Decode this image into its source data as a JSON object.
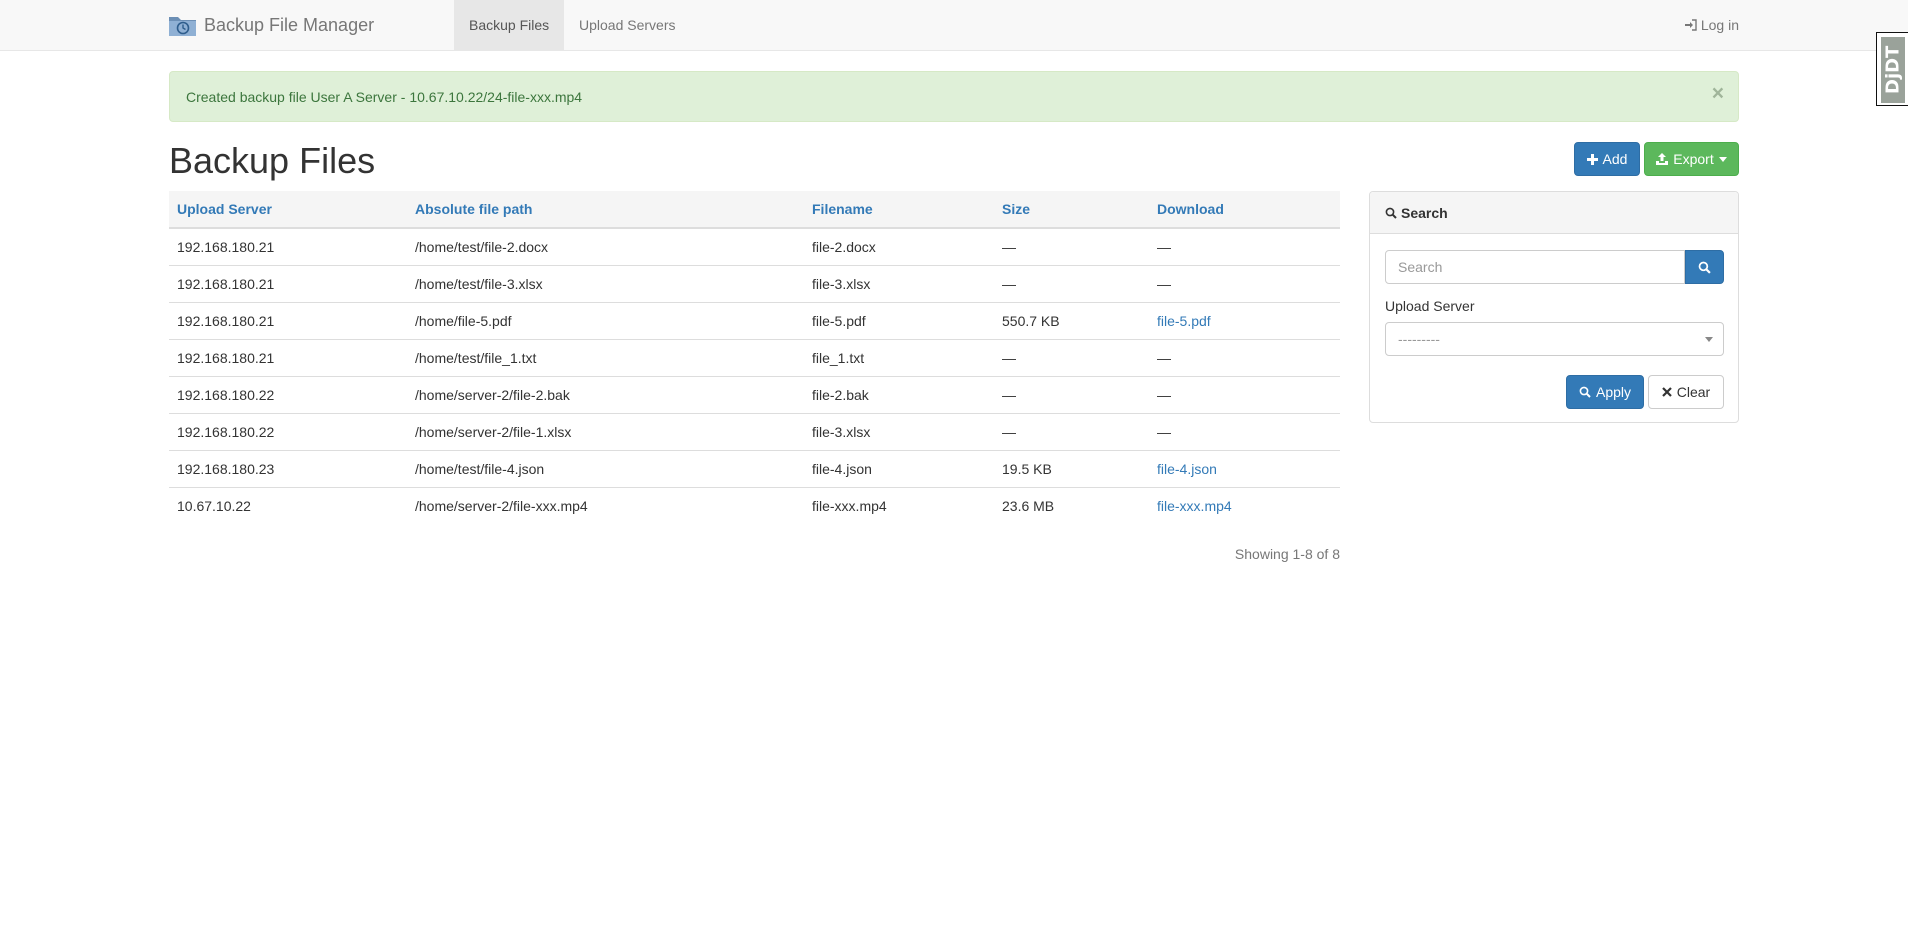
{
  "navbar": {
    "brand": "Backup File Manager",
    "tabs": [
      {
        "label": "Backup Files",
        "active": true
      },
      {
        "label": "Upload Servers",
        "active": false
      }
    ],
    "login": "Log in"
  },
  "debug_toolbar": {
    "label": "DjDT"
  },
  "alert": {
    "message": "Created backup file User A Server - 10.67.10.22/24-file-xxx.mp4",
    "close": "×"
  },
  "page": {
    "title": "Backup Files"
  },
  "actions": {
    "add_label": "Add",
    "export_label": "Export"
  },
  "table": {
    "headers": [
      "Upload Server",
      "Absolute file path",
      "Filename",
      "Size",
      "Download"
    ],
    "rows": [
      {
        "server": "192.168.180.21",
        "path": "/home/test/file-2.docx",
        "filename": "file-2.docx",
        "size": "—",
        "download": "—",
        "download_link": false
      },
      {
        "server": "192.168.180.21",
        "path": "/home/test/file-3.xlsx",
        "filename": "file-3.xlsx",
        "size": "—",
        "download": "—",
        "download_link": false
      },
      {
        "server": "192.168.180.21",
        "path": "/home/file-5.pdf",
        "filename": "file-5.pdf",
        "size": "550.7 KB",
        "download": "file-5.pdf",
        "download_link": true
      },
      {
        "server": "192.168.180.21",
        "path": "/home/test/file_1.txt",
        "filename": "file_1.txt",
        "size": "—",
        "download": "—",
        "download_link": false
      },
      {
        "server": "192.168.180.22",
        "path": "/home/server-2/file-2.bak",
        "filename": "file-2.bak",
        "size": "—",
        "download": "—",
        "download_link": false
      },
      {
        "server": "192.168.180.22",
        "path": "/home/server-2/file-1.xlsx",
        "filename": "file-3.xlsx",
        "size": "—",
        "download": "—",
        "download_link": false
      },
      {
        "server": "192.168.180.23",
        "path": "/home/test/file-4.json",
        "filename": "file-4.json",
        "size": "19.5 KB",
        "download": "file-4.json",
        "download_link": true
      },
      {
        "server": "10.67.10.22",
        "path": "/home/server-2/file-xxx.mp4",
        "filename": "file-xxx.mp4",
        "size": "23.6 MB",
        "download": "file-xxx.mp4",
        "download_link": true
      }
    ],
    "showing": "Showing 1-8 of 8"
  },
  "search_panel": {
    "title": "Search",
    "search_placeholder": "Search",
    "upload_server_label": "Upload Server",
    "upload_server_value": "---------",
    "apply_label": "Apply",
    "clear_label": "Clear"
  },
  "colors": {
    "primary": "#337ab7",
    "success": "#5cb85c",
    "alert_bg": "#dff0d8",
    "alert_text": "#3c763d",
    "navbar_bg": "#f8f8f8"
  },
  "icons": [
    "backup-logo-icon",
    "login-icon",
    "plus-icon",
    "upload-icon",
    "caret-down-icon",
    "search-icon",
    "close-icon"
  ]
}
